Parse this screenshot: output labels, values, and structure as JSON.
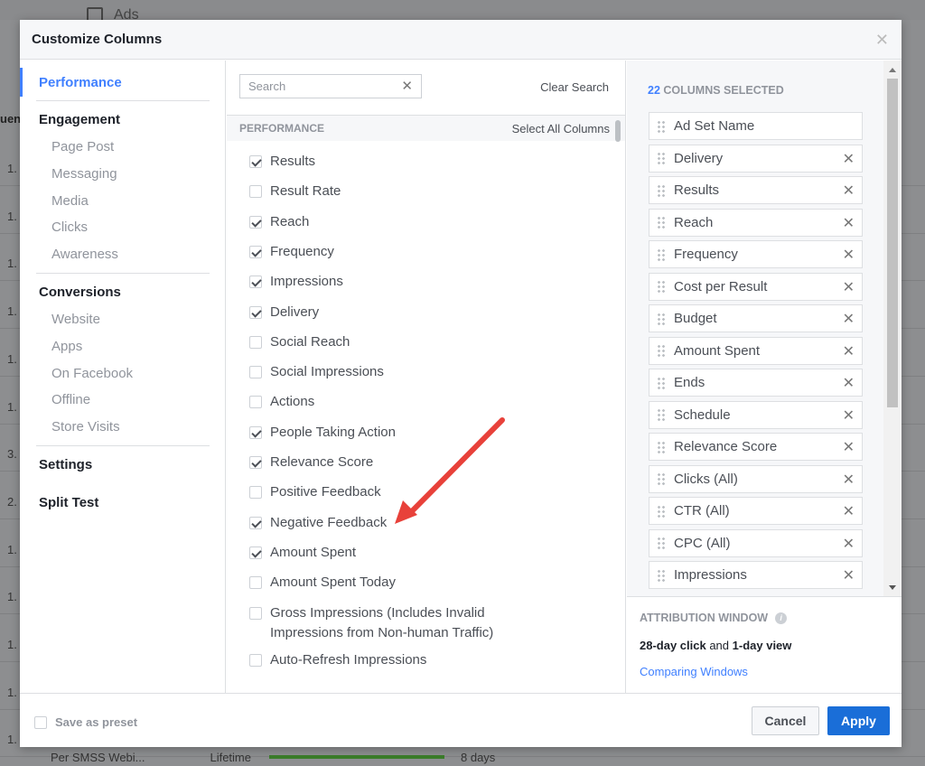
{
  "background": {
    "tab_label": "Ads",
    "column_fragment": "uen",
    "row_values": [
      "1.",
      "1.",
      "1.",
      "1.",
      "1.",
      "1.",
      "3.",
      "2.",
      "1.",
      "1.",
      "1.",
      "1.",
      "1."
    ],
    "bottom_row": {
      "name": "Per SMSS Webi...",
      "schedule": "Lifetime",
      "duration": "8 days",
      "bar_color": "#3b7d2a"
    }
  },
  "dialog": {
    "title": "Customize Columns",
    "close_icon": "close-icon",
    "nav": {
      "active": "Performance",
      "groups": [
        {
          "label": "Performance",
          "items": []
        },
        {
          "label": "Engagement",
          "items": [
            "Page Post",
            "Messaging",
            "Media",
            "Clicks",
            "Awareness"
          ]
        },
        {
          "label": "Conversions",
          "items": [
            "Website",
            "Apps",
            "On Facebook",
            "Offline",
            "Store Visits"
          ]
        },
        {
          "label": "Settings",
          "items": []
        },
        {
          "label": "Split Test",
          "items": []
        }
      ]
    },
    "search": {
      "placeholder": "Search",
      "value": "",
      "clear_label": "Clear Search"
    },
    "section": {
      "title": "PERFORMANCE",
      "select_all": "Select All Columns"
    },
    "options": [
      {
        "label": "Results",
        "checked": true
      },
      {
        "label": "Result Rate",
        "checked": false
      },
      {
        "label": "Reach",
        "checked": true
      },
      {
        "label": "Frequency",
        "checked": true
      },
      {
        "label": "Impressions",
        "checked": true
      },
      {
        "label": "Delivery",
        "checked": true
      },
      {
        "label": "Social Reach",
        "checked": false
      },
      {
        "label": "Social Impressions",
        "checked": false
      },
      {
        "label": "Actions",
        "checked": false
      },
      {
        "label": "People Taking Action",
        "checked": true
      },
      {
        "label": "Relevance Score",
        "checked": true
      },
      {
        "label": "Positive Feedback",
        "checked": false
      },
      {
        "label": "Negative Feedback",
        "checked": true
      },
      {
        "label": "Amount Spent",
        "checked": true
      },
      {
        "label": "Amount Spent Today",
        "checked": false
      },
      {
        "label": "Gross Impressions (Includes Invalid Impressions from Non-human Traffic)",
        "checked": false
      },
      {
        "label": "Auto-Refresh Impressions",
        "checked": false
      }
    ],
    "selected": {
      "count": "22",
      "label": "COLUMNS SELECTED",
      "columns": [
        {
          "label": "Ad Set Name",
          "removable": false
        },
        {
          "label": "Delivery",
          "removable": true
        },
        {
          "label": "Results",
          "removable": true
        },
        {
          "label": "Reach",
          "removable": true
        },
        {
          "label": "Frequency",
          "removable": true
        },
        {
          "label": "Cost per Result",
          "removable": true
        },
        {
          "label": "Budget",
          "removable": true
        },
        {
          "label": "Amount Spent",
          "removable": true
        },
        {
          "label": "Ends",
          "removable": true
        },
        {
          "label": "Schedule",
          "removable": true
        },
        {
          "label": "Relevance Score",
          "removable": true
        },
        {
          "label": "Clicks (All)",
          "removable": true
        },
        {
          "label": "CTR (All)",
          "removable": true
        },
        {
          "label": "CPC (All)",
          "removable": true
        },
        {
          "label": "Impressions",
          "removable": true
        }
      ]
    },
    "attribution": {
      "title": "ATTRIBUTION WINDOW",
      "click": "28-day click",
      "and": " and ",
      "view": "1-day view",
      "link": "Comparing Windows"
    },
    "footer": {
      "save_preset": "Save as preset",
      "cancel": "Cancel",
      "apply": "Apply"
    },
    "colors": {
      "accent": "#4080ff",
      "apply": "#1a6ed8",
      "annotation_arrow": "#e8413a"
    }
  }
}
